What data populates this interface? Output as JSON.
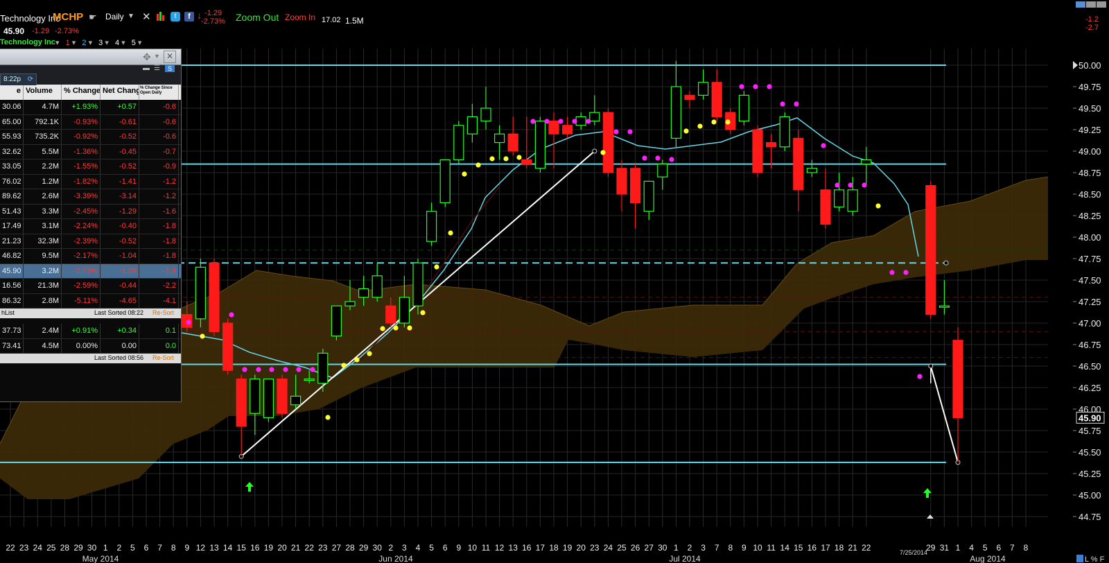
{
  "header": {
    "company_name": "Technology Inc",
    "symbol": "MCHP",
    "period": "Daily",
    "change": "-1.29",
    "change_pct": "-2.73%",
    "zoom_out": "Zoom Out",
    "zoom_in": "Zoom In",
    "info_value": "17.02",
    "info_volume": "1.5M",
    "last_price": "45.90",
    "last_change": "-1.29",
    "last_change_pct": "-2.73%",
    "series_label": "Technology Inc",
    "series_tabs": [
      "1",
      "2",
      "3",
      "4",
      "5"
    ],
    "corner_change": "-1.2",
    "corner_change_pct": "-2.7",
    "price_tag": "45.90",
    "date_tag": "7/25/2014",
    "colors": {
      "up": "#22ff22",
      "down": "#ff1a1a",
      "cyan": "#66d9e8",
      "yellow": "#ffff33",
      "magenta": "#ff22ff",
      "cloud": "#3a2a0a"
    }
  },
  "watchlist": {
    "tab_time": "8:22p",
    "columns": [
      "e",
      "Volume",
      "% Change",
      "Net Change",
      "% Change Since Open Daily"
    ],
    "rows": [
      [
        "30.06",
        "4.7M",
        "+1.93%",
        "+0.57",
        "-0.6"
      ],
      [
        "65.00",
        "792.1K",
        "-0.93%",
        "-0.61",
        "-0.6"
      ],
      [
        "55.93",
        "735.2K",
        "-0.92%",
        "-0.52",
        "-0.6"
      ],
      [
        "32.62",
        "5.5M",
        "-1.36%",
        "-0.45",
        "-0.7"
      ],
      [
        "33.05",
        "2.2M",
        "-1.55%",
        "-0.52",
        "-0.9"
      ],
      [
        "76.02",
        "1.2M",
        "-1.82%",
        "-1.41",
        "-1.2"
      ],
      [
        "89.62",
        "2.6M",
        "-3.39%",
        "-3.14",
        "-1.2"
      ],
      [
        "51.43",
        "3.3M",
        "-2.45%",
        "-1.29",
        "-1.6"
      ],
      [
        "17.49",
        "3.1M",
        "-2.24%",
        "-0.40",
        "-1.8"
      ],
      [
        "21.23",
        "32.3M",
        "-2.39%",
        "-0.52",
        "-1.8"
      ],
      [
        "46.82",
        "9.5M",
        "-2.17%",
        "-1.04",
        "-1.8"
      ],
      [
        "45.90",
        "3.2M",
        "-2.73%",
        "-1.29",
        "-1.9"
      ],
      [
        "16.56",
        "21.3M",
        "-2.59%",
        "-0.44",
        "-2.2"
      ],
      [
        "86.32",
        "2.8M",
        "-5.11%",
        "-4.65",
        "-4.1"
      ]
    ],
    "footer_left": "hList",
    "footer_sorted": "Last Sorted 08:22",
    "footer_resort": "Re-Sort",
    "rows2": [
      [
        "37.73",
        "2.4M",
        "+0.91%",
        "+0.34",
        "0.1"
      ],
      [
        "73.41",
        "4.5M",
        "0.00%",
        "0.00",
        "0.0"
      ]
    ],
    "footer2_sorted": "Last Sorted 08:56",
    "footer2_resort": "Re-Sort"
  },
  "chart_data": {
    "type": "candlestick",
    "ylim": [
      44.6,
      50.1
    ],
    "y_ticks": [
      "50.00",
      "49.75",
      "49.50",
      "49.25",
      "49.00",
      "48.75",
      "48.50",
      "48.25",
      "48.00",
      "47.75",
      "47.50",
      "47.25",
      "47.00",
      "46.75",
      "46.50",
      "46.25",
      "46.00",
      "45.75",
      "45.50",
      "45.25",
      "45.00",
      "44.75"
    ],
    "x_ticks": [
      "22",
      "23",
      "24",
      "25",
      "28",
      "29",
      "30",
      "1",
      "2",
      "5",
      "6",
      "7",
      "8",
      "9",
      "12",
      "13",
      "14",
      "15",
      "16",
      "19",
      "20",
      "21",
      "22",
      "23",
      "27",
      "28",
      "29",
      "30",
      "2",
      "3",
      "4",
      "5",
      "6",
      "9",
      "10",
      "11",
      "12",
      "13",
      "16",
      "17",
      "18",
      "19",
      "20",
      "23",
      "24",
      "25",
      "26",
      "27",
      "30",
      "1",
      "2",
      "3",
      "7",
      "8",
      "9",
      "10",
      "11",
      "14",
      "15",
      "16",
      "17",
      "18",
      "21",
      "22",
      "29",
      "31",
      "1",
      "4",
      "5",
      "6",
      "7",
      "8"
    ],
    "month_labels": [
      "May 2014",
      "Jun 2014",
      "Jul 2014",
      "Aug 2014"
    ],
    "horizontal_lines": [
      50.0,
      48.85,
      46.52,
      45.38
    ],
    "dashed_line": 47.7,
    "candles": [
      {
        "date": "May 9",
        "o": 47.1,
        "h": 47.25,
        "c": 46.95,
        "l": 46.9
      },
      {
        "date": "May 12",
        "o": 47.05,
        "h": 47.75,
        "c": 47.65,
        "l": 46.95
      },
      {
        "date": "May 13",
        "o": 47.7,
        "h": 47.75,
        "c": 46.9,
        "l": 46.85
      },
      {
        "date": "May 14",
        "o": 47.0,
        "h": 47.05,
        "c": 46.45,
        "l": 46.4
      },
      {
        "date": "May 15",
        "o": 46.35,
        "h": 46.4,
        "c": 45.8,
        "l": 45.45
      },
      {
        "date": "May 16",
        "o": 45.95,
        "h": 46.4,
        "c": 46.35,
        "l": 45.7
      },
      {
        "date": "May 19",
        "o": 45.9,
        "h": 46.35,
        "c": 46.35,
        "l": 45.85
      },
      {
        "date": "May 20",
        "o": 46.35,
        "h": 46.4,
        "c": 45.95,
        "l": 45.9
      },
      {
        "date": "May 21",
        "o": 46.05,
        "h": 46.4,
        "c": 46.15,
        "l": 46.0
      },
      {
        "date": "May 22",
        "o": 46.35,
        "h": 46.45,
        "c": 46.35,
        "l": 46.3
      },
      {
        "date": "May 23",
        "o": 46.3,
        "h": 46.7,
        "c": 46.65,
        "l": 46.2
      },
      {
        "date": "May 27",
        "o": 46.85,
        "h": 47.2,
        "c": 47.2,
        "l": 46.8
      },
      {
        "date": "May 28",
        "o": 47.2,
        "h": 47.5,
        "c": 47.25,
        "l": 47.15
      },
      {
        "date": "May 29",
        "o": 47.3,
        "h": 47.55,
        "c": 47.4,
        "l": 47.2
      },
      {
        "date": "May 30",
        "o": 47.3,
        "h": 47.7,
        "c": 47.55,
        "l": 47.25
      },
      {
        "date": "Jun 2",
        "o": 47.2,
        "h": 47.3,
        "c": 47.0,
        "l": 46.95
      },
      {
        "date": "Jun 3",
        "o": 47.0,
        "h": 47.55,
        "c": 47.3,
        "l": 46.95
      },
      {
        "date": "Jun 4",
        "o": 47.2,
        "h": 47.75,
        "c": 47.7,
        "l": 47.1
      },
      {
        "date": "Jun 5",
        "o": 47.95,
        "h": 48.4,
        "c": 48.3,
        "l": 47.9
      },
      {
        "date": "Jun 6",
        "o": 48.4,
        "h": 48.9,
        "c": 48.9,
        "l": 48.35
      },
      {
        "date": "Jun 9",
        "o": 48.9,
        "h": 49.35,
        "c": 49.3,
        "l": 48.85
      },
      {
        "date": "Jun 10",
        "o": 49.2,
        "h": 49.55,
        "c": 49.4,
        "l": 49.1
      },
      {
        "date": "Jun 11",
        "o": 49.35,
        "h": 49.75,
        "c": 49.5,
        "l": 49.25
      },
      {
        "date": "Jun 12",
        "o": 49.1,
        "h": 49.3,
        "c": 49.2,
        "l": 48.9
      },
      {
        "date": "Jun 13",
        "o": 49.2,
        "h": 49.4,
        "c": 49.0,
        "l": 48.95
      },
      {
        "date": "Jun 16",
        "o": 48.9,
        "h": 49.4,
        "c": 48.85,
        "l": 48.8
      },
      {
        "date": "Jun 17",
        "o": 48.8,
        "h": 49.4,
        "c": 49.35,
        "l": 48.75
      },
      {
        "date": "Jun 18",
        "o": 49.35,
        "h": 49.45,
        "c": 49.2,
        "l": 48.8
      },
      {
        "date": "Jun 19",
        "o": 49.3,
        "h": 49.4,
        "c": 49.2,
        "l": 49.15
      },
      {
        "date": "Jun 20",
        "o": 49.3,
        "h": 49.45,
        "c": 49.4,
        "l": 49.25
      },
      {
        "date": "Jun 23",
        "o": 49.35,
        "h": 49.65,
        "c": 49.45,
        "l": 49.3
      },
      {
        "date": "Jun 24",
        "o": 49.45,
        "h": 49.5,
        "c": 48.75,
        "l": 48.7
      },
      {
        "date": "Jun 25",
        "o": 48.8,
        "h": 48.9,
        "c": 48.5,
        "l": 48.3
      },
      {
        "date": "Jun 26",
        "o": 48.8,
        "h": 48.85,
        "c": 48.4,
        "l": 48.1
      },
      {
        "date": "Jun 27",
        "o": 48.3,
        "h": 48.65,
        "c": 48.65,
        "l": 48.2
      },
      {
        "date": "Jun 30",
        "o": 48.7,
        "h": 48.9,
        "c": 48.85,
        "l": 48.55
      },
      {
        "date": "Jul 1",
        "o": 49.15,
        "h": 50.05,
        "c": 49.75,
        "l": 49.05
      },
      {
        "date": "Jul 2",
        "o": 49.65,
        "h": 49.7,
        "c": 49.6,
        "l": 49.5
      },
      {
        "date": "Jul 3",
        "o": 49.65,
        "h": 49.95,
        "c": 49.8,
        "l": 49.6
      },
      {
        "date": "Jul 7",
        "o": 49.8,
        "h": 49.95,
        "c": 49.4,
        "l": 49.35
      },
      {
        "date": "Jul 8",
        "o": 49.45,
        "h": 49.5,
        "c": 49.25,
        "l": 49.2
      },
      {
        "date": "Jul 9",
        "o": 49.35,
        "h": 49.7,
        "c": 49.65,
        "l": 49.3
      },
      {
        "date": "Jul 10",
        "o": 49.25,
        "h": 49.3,
        "c": 48.75,
        "l": 48.7
      },
      {
        "date": "Jul 11",
        "o": 49.1,
        "h": 49.2,
        "c": 49.05,
        "l": 48.8
      },
      {
        "date": "Jul 14",
        "o": 49.05,
        "h": 49.45,
        "c": 49.4,
        "l": 49.0
      },
      {
        "date": "Jul 15",
        "o": 49.15,
        "h": 49.25,
        "c": 48.55,
        "l": 48.3
      },
      {
        "date": "Jul 16",
        "o": 48.75,
        "h": 48.9,
        "c": 48.8,
        "l": 48.7
      },
      {
        "date": "Jul 17",
        "o": 48.55,
        "h": 48.8,
        "c": 48.15,
        "l": 48.1
      },
      {
        "date": "Jul 18",
        "o": 48.35,
        "h": 48.75,
        "c": 48.55,
        "l": 48.3
      },
      {
        "date": "Jul 21",
        "o": 48.3,
        "h": 48.7,
        "c": 48.55,
        "l": 48.25
      },
      {
        "date": "Jul 22",
        "o": 48.85,
        "h": 49.05,
        "c": 48.9,
        "l": 48.6
      },
      {
        "date": "Jul 23",
        "o": 48.6,
        "h": 48.65,
        "c": 47.1,
        "l": 47.05
      },
      {
        "date": "Jul 24",
        "o": 47.2,
        "h": 47.5,
        "c": 47.2,
        "l": 47.1
      },
      {
        "date": "Jul 25",
        "o": 46.8,
        "h": 46.95,
        "c": 45.9,
        "l": 45.38
      }
    ],
    "line_points": [
      [
        "May 15",
        45.45
      ],
      [
        "Jun 23",
        49.0
      ]
    ],
    "line_points_2": [
      [
        "Jul 25",
        45.38
      ],
      [
        "Jul 29",
        46.5
      ]
    ]
  }
}
